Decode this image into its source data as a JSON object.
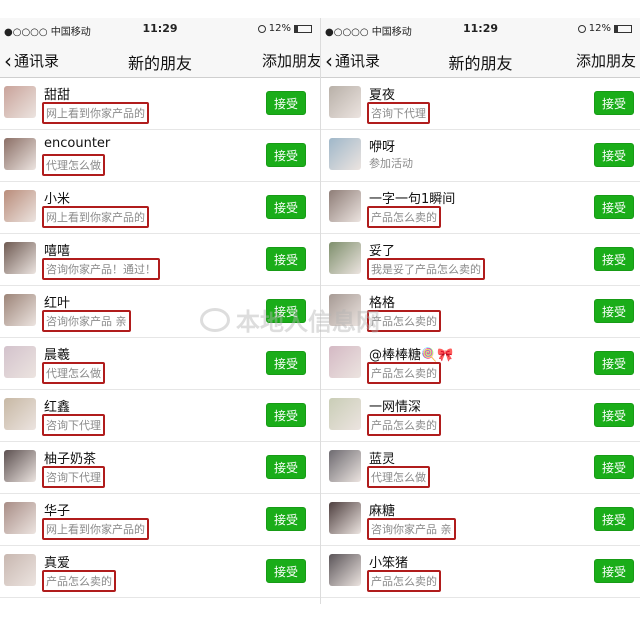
{
  "status": {
    "carrier": "●○○○○ 中国移动",
    "time": "11:29",
    "battery": "12%"
  },
  "nav": {
    "back": "通讯录",
    "title": "新的朋友",
    "add": "添加朋友"
  },
  "accept_label": "接受",
  "watermark": "本地人信息网",
  "left_list": [
    {
      "name": "甜甜",
      "msg": "网上看到你家产品的",
      "boxed": true,
      "color": "#c9a39a"
    },
    {
      "name": "encounter",
      "msg": "代理怎么做",
      "boxed": true,
      "color": "#8b6f66"
    },
    {
      "name": "小米",
      "msg": "网上看到你家产品的",
      "boxed": true,
      "color": "#b98c7a"
    },
    {
      "name": "嘻嘻",
      "msg": "咨询你家产品！通过！",
      "boxed": true,
      "color": "#6e5a52"
    },
    {
      "name": "红叶",
      "msg": "咨询你家产品 亲",
      "boxed": true,
      "color": "#9c8478"
    },
    {
      "name": "晨羲",
      "msg": "代理怎么做",
      "boxed": true,
      "color": "#d3c2cc"
    },
    {
      "name": "红鑫",
      "msg": "咨询下代理",
      "boxed": true,
      "color": "#c7b8a4"
    },
    {
      "name": "柚子奶茶",
      "msg": "咨询下代理",
      "boxed": true,
      "color": "#5c5050"
    },
    {
      "name": "华子",
      "msg": "网上看到你家产品的",
      "boxed": true,
      "color": "#a88d86"
    },
    {
      "name": "真爱",
      "msg": "产品怎么卖的",
      "boxed": true,
      "color": "#c8b7b0"
    }
  ],
  "right_list": [
    {
      "name": "夏夜",
      "msg": "咨询下代理",
      "boxed": true,
      "color": "#b8b0a8"
    },
    {
      "name": "咿呀",
      "msg": "参加活动",
      "boxed": false,
      "color": "#9fb7c9"
    },
    {
      "name": "一字一句1瞬间",
      "msg": "产品怎么卖的",
      "boxed": true,
      "color": "#8e7d77"
    },
    {
      "name": "妥了",
      "msg": "我是妥了产品怎么卖的",
      "boxed": true,
      "color": "#7e8f6c"
    },
    {
      "name": "格格",
      "msg": "产品怎么卖的",
      "boxed": true,
      "color": "#a69a94"
    },
    {
      "name": "@棒棒糖🍭🎀",
      "msg": "产品怎么卖的",
      "boxed": true,
      "color": "#d4b9c4"
    },
    {
      "name": "一网情深",
      "msg": "产品怎么卖的",
      "boxed": true,
      "color": "#c9cdb6"
    },
    {
      "name": "蓝灵",
      "msg": "代理怎么做",
      "boxed": true,
      "color": "#6d6a70"
    },
    {
      "name": "麻糖",
      "msg": "咨询你家产品 亲",
      "boxed": true,
      "color": "#4e3f3f"
    },
    {
      "name": "小笨猪",
      "msg": "产品怎么卖的",
      "boxed": true,
      "color": "#5a5458"
    }
  ]
}
